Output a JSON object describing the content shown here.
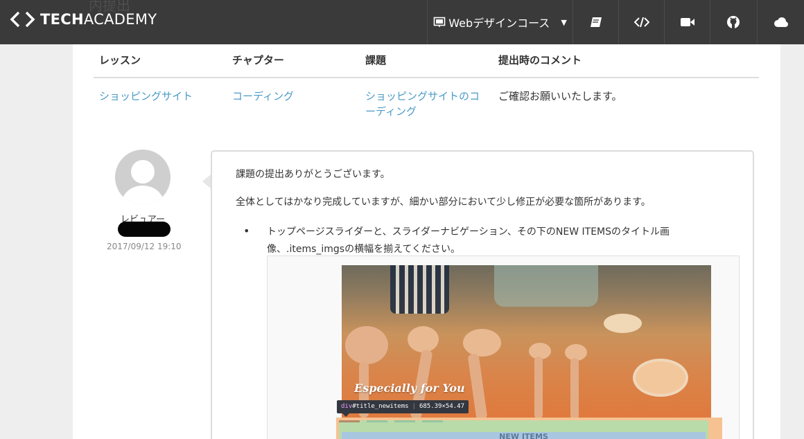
{
  "nav": {
    "logo_tech": "TECH",
    "logo_academy": "ACADEMY",
    "course_label": "Webデザインコース",
    "ghost_title": "内提出",
    "icons": [
      "book-icon",
      "code-icon",
      "video-icon",
      "github-icon",
      "cloud-icon"
    ]
  },
  "table": {
    "headers": [
      "レッスン",
      "チャプター",
      "課題",
      "提出時のコメント"
    ],
    "row": {
      "lesson": "ショッピングサイト",
      "chapter": "コーディング",
      "task_line1": "ショッピングサイトのコ",
      "task_line2": "ーディング",
      "comment": "ご確認お願いいたします。"
    }
  },
  "review": {
    "reviewer_label": "レビュアー",
    "date": "2017/09/12 19:10",
    "para1": "課題の提出ありがとうございます。",
    "para2": "全体としてはかなり完成していますが、細かい部分において少し修正が必要な箇所があります。",
    "bullet_line1": "トップページスライダーと、スライダーナビゲーション、その下のNEW ITEMSのタイトル画",
    "bullet_line2": "像、.items_imgsの横幅を揃えてください。"
  },
  "screenshot": {
    "photo_caption": "Especially for You",
    "tooltip_tag": "div",
    "tooltip_id": "#title_newitems",
    "tooltip_size": "685.39×54.47",
    "new_items_label": "NEW ITEMS"
  },
  "colors": {
    "nav_bg": "#3a3a3a",
    "link": "#4a9bc7"
  }
}
